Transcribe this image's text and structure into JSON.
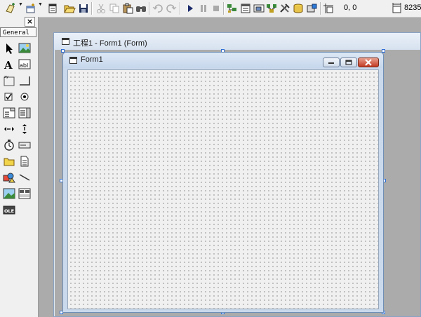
{
  "toolbar": {
    "coords": "0, 0",
    "size_partial": "8235",
    "icons": [
      "add-project-icon",
      "add-form-icon",
      "menu-editor-icon",
      "open-project-icon",
      "save-project-icon",
      "cut-icon",
      "copy-icon",
      "paste-icon",
      "find-icon",
      "undo-icon",
      "redo-icon",
      "start-icon",
      "break-icon",
      "end-icon",
      "project-explorer-icon",
      "properties-window-icon",
      "form-layout-icon",
      "object-browser-icon",
      "toolbox-icon",
      "data-view-icon",
      "component-manager-icon",
      "position-icon",
      "size-icon"
    ]
  },
  "toolbox": {
    "close_label": "×",
    "tab_label": "General",
    "tools": [
      "pointer",
      "picturebox",
      "label",
      "textbox",
      "frame",
      "commandbutton",
      "checkbox",
      "optionbutton",
      "combobox",
      "listbox",
      "hscrollbar",
      "vscrollbar",
      "timer",
      "drivelistbox",
      "dirlistbox",
      "filelistbox",
      "shape",
      "line",
      "image",
      "data",
      "ole"
    ]
  },
  "designer": {
    "window_title": "工程1 - Form1 (Form)",
    "form_caption": "Form1"
  },
  "colors": {
    "workspace": "#ababab",
    "form_client": "#f0f0f0",
    "title_bar": "#c6d7ec",
    "close_button": "#c23a22"
  }
}
